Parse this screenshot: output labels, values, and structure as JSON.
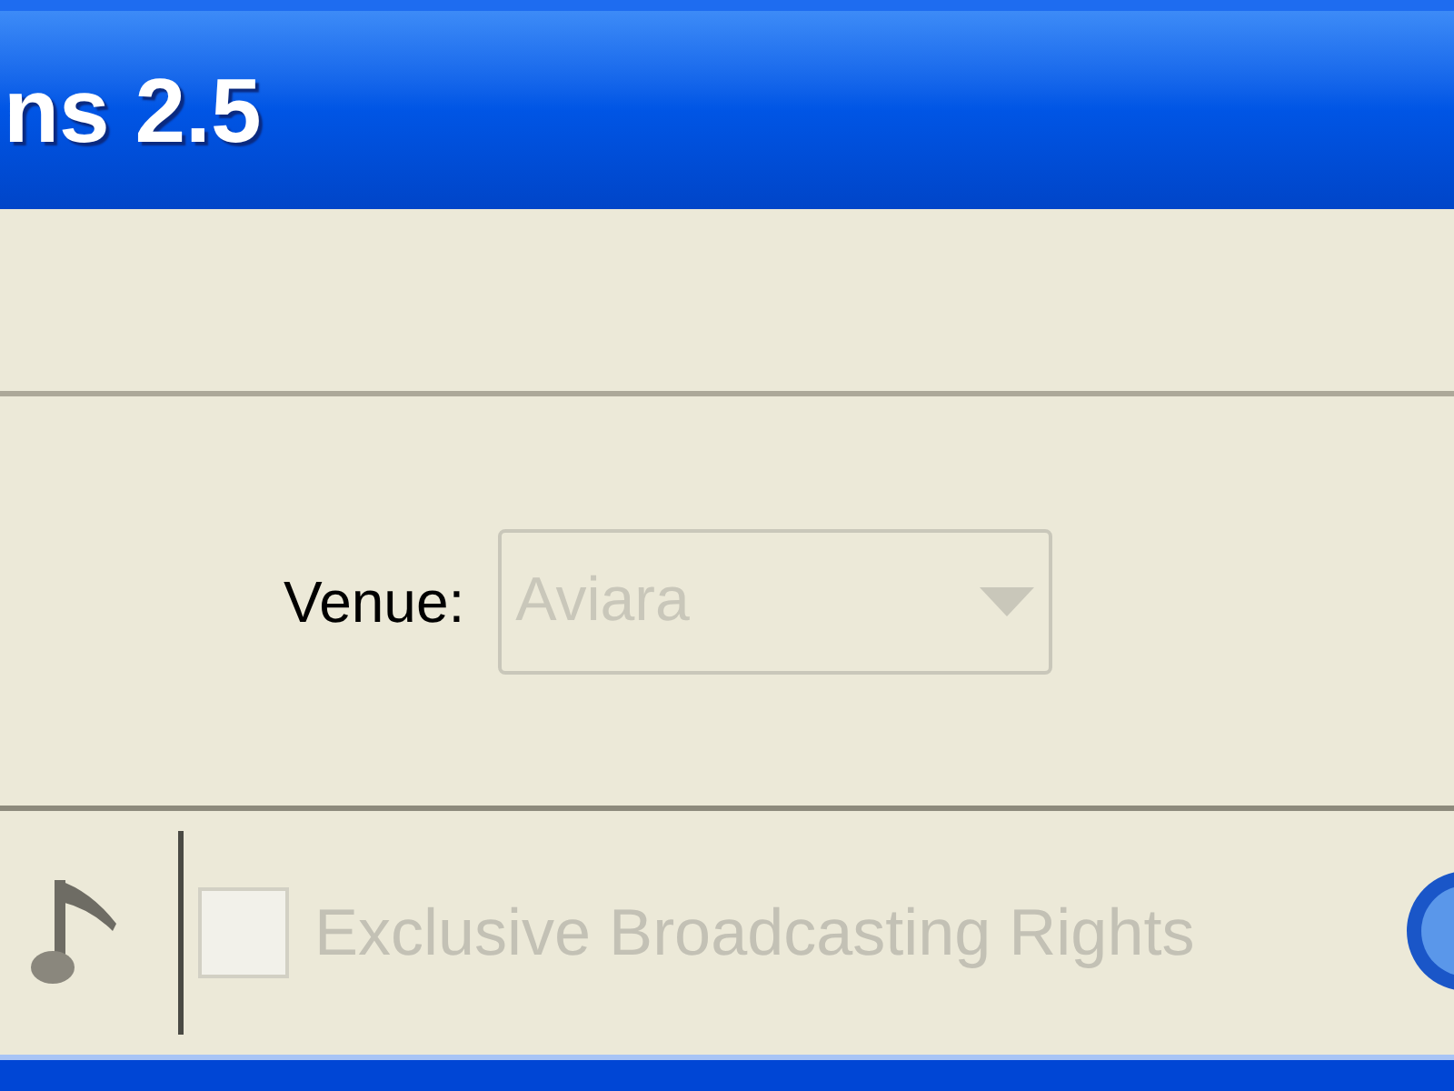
{
  "window": {
    "title": "ns 2.5"
  },
  "venue": {
    "label": "Venue:",
    "value": "Aviara",
    "disabled": true
  },
  "option": {
    "label": "Exclusive Broadcasting Rights",
    "checked": false,
    "disabled": true
  }
}
